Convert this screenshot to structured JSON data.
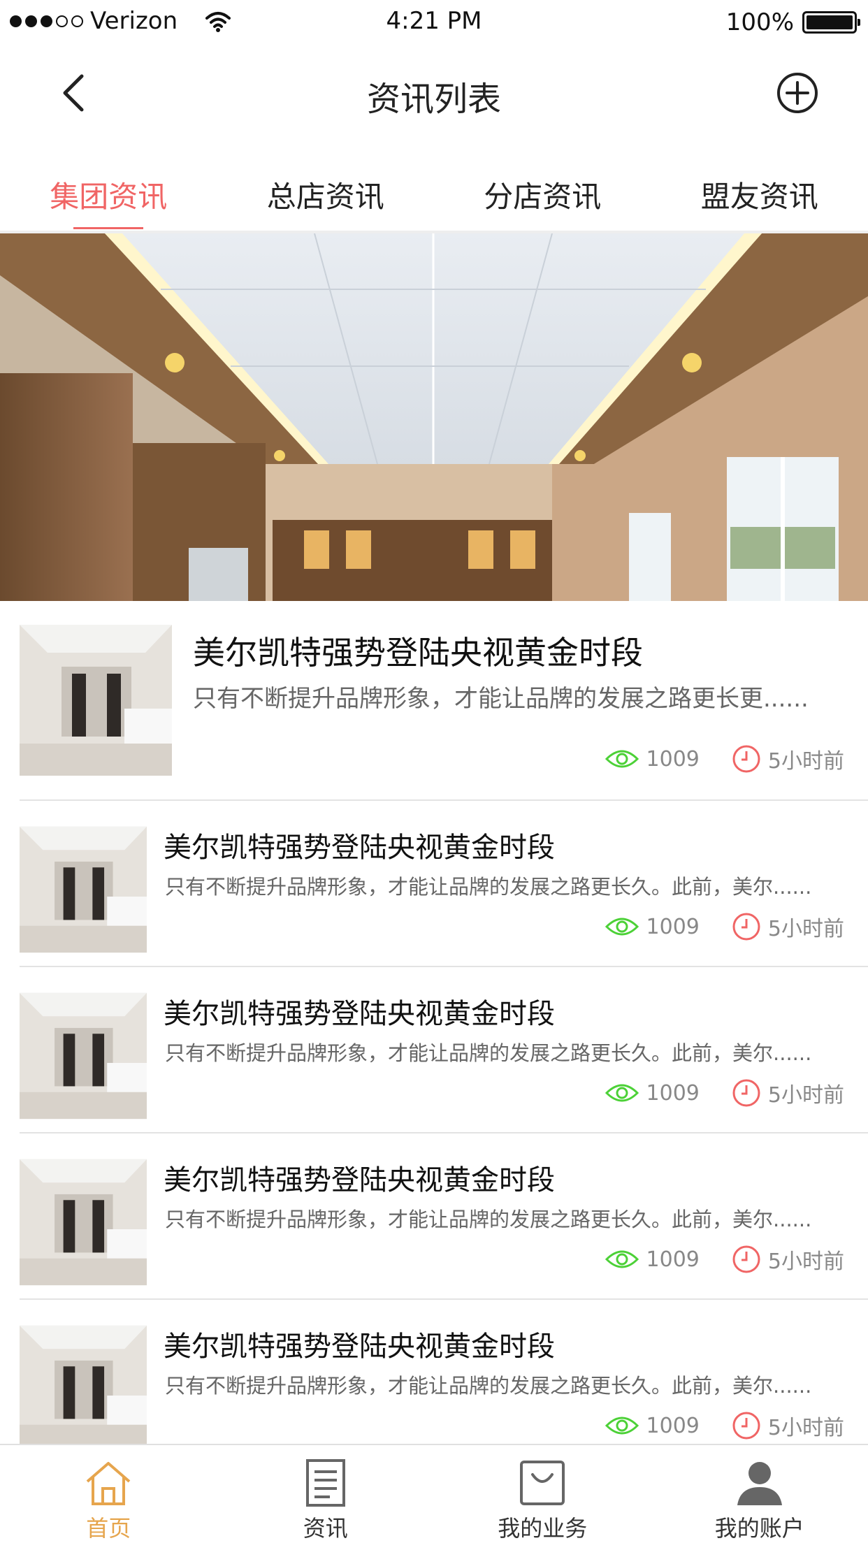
{
  "status_bar": {
    "carrier": "Verizon",
    "time": "4:21 PM",
    "battery": "100%"
  },
  "header": {
    "title": "资讯列表",
    "back_icon": "chevron-left-icon",
    "add_icon": "plus-circle-icon"
  },
  "tabs": [
    {
      "label": "集团资讯",
      "active": true
    },
    {
      "label": "总店资讯",
      "active": false
    },
    {
      "label": "分店资讯",
      "active": false
    },
    {
      "label": "盟友资讯",
      "active": false
    }
  ],
  "colors": {
    "accent": "#f06565",
    "tabbar_active": "#e6a54d",
    "views_icon": "#4cd137",
    "time_icon": "#f06565"
  },
  "news": [
    {
      "title": "美尔凯特强势登陆央视黄金时段",
      "desc": "只有不断提升品牌形象，才能让品牌的发展之路更长更......",
      "views": "1009",
      "time": "5小时前"
    },
    {
      "title": "美尔凯特强势登陆央视黄金时段",
      "desc": "只有不断提升品牌形象，才能让品牌的发展之路更长久。此前，美尔......",
      "views": "1009",
      "time": "5小时前"
    },
    {
      "title": "美尔凯特强势登陆央视黄金时段",
      "desc": "只有不断提升品牌形象，才能让品牌的发展之路更长久。此前，美尔......",
      "views": "1009",
      "time": "5小时前"
    },
    {
      "title": "美尔凯特强势登陆央视黄金时段",
      "desc": "只有不断提升品牌形象，才能让品牌的发展之路更长久。此前，美尔......",
      "views": "1009",
      "time": "5小时前"
    },
    {
      "title": "美尔凯特强势登陆央视黄金时段",
      "desc": "只有不断提升品牌形象，才能让品牌的发展之路更长久。此前，美尔......",
      "views": "1009",
      "time": "5小时前"
    }
  ],
  "tabbar": [
    {
      "label": "首页",
      "icon": "home-icon",
      "active": true
    },
    {
      "label": "资讯",
      "icon": "document-icon",
      "active": false
    },
    {
      "label": "我的业务",
      "icon": "bag-icon",
      "active": false
    },
    {
      "label": "我的账户",
      "icon": "user-icon",
      "active": false
    }
  ]
}
